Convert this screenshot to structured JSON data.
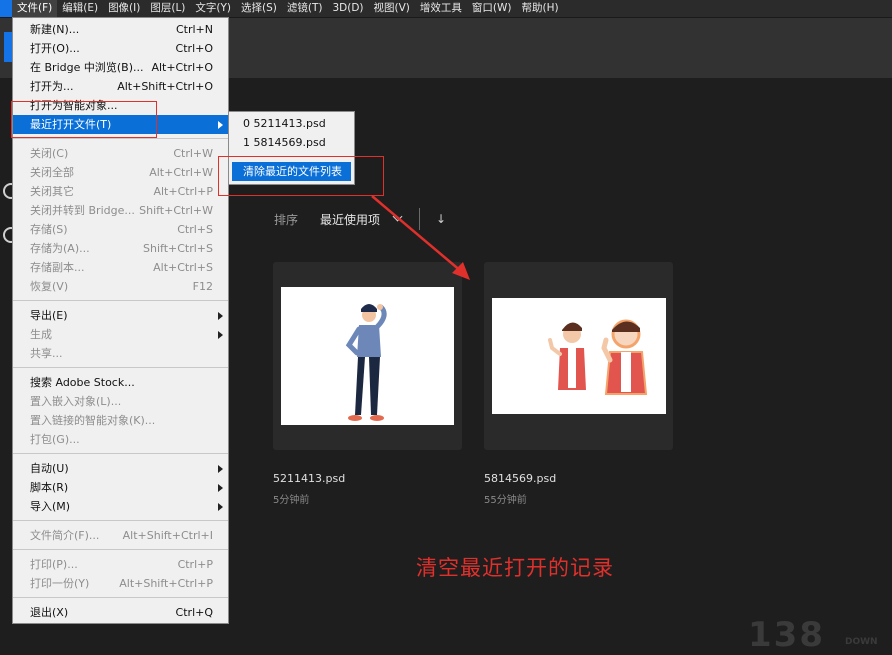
{
  "menubar": {
    "items": [
      "文件(F)",
      "编辑(E)",
      "图像(I)",
      "图层(L)",
      "文字(Y)",
      "选择(S)",
      "滤镜(T)",
      "3D(D)",
      "视图(V)",
      "增效工具",
      "窗口(W)",
      "帮助(H)"
    ]
  },
  "file_menu": {
    "items": [
      {
        "label": "新建(N)...",
        "shortcut": "Ctrl+N",
        "enabled": true
      },
      {
        "label": "打开(O)...",
        "shortcut": "Ctrl+O",
        "enabled": true
      },
      {
        "label": "在 Bridge 中浏览(B)...",
        "shortcut": "Alt+Ctrl+O",
        "enabled": true
      },
      {
        "label": "打开为...",
        "shortcut": "Alt+Shift+Ctrl+O",
        "enabled": true
      },
      {
        "label": "打开为智能对象...",
        "shortcut": "",
        "enabled": true
      },
      {
        "label": "最近打开文件(T)",
        "shortcut": "",
        "enabled": true,
        "submenu": true,
        "highlighted": true
      },
      {
        "label": "关闭(C)",
        "shortcut": "Ctrl+W",
        "enabled": false
      },
      {
        "label": "关闭全部",
        "shortcut": "Alt+Ctrl+W",
        "enabled": false
      },
      {
        "label": "关闭其它",
        "shortcut": "Alt+Ctrl+P",
        "enabled": false
      },
      {
        "label": "关闭并转到 Bridge...",
        "shortcut": "Shift+Ctrl+W",
        "enabled": false
      },
      {
        "label": "存储(S)",
        "shortcut": "Ctrl+S",
        "enabled": false
      },
      {
        "label": "存储为(A)...",
        "shortcut": "Shift+Ctrl+S",
        "enabled": false
      },
      {
        "label": "存储副本...",
        "shortcut": "Alt+Ctrl+S",
        "enabled": false
      },
      {
        "label": "恢复(V)",
        "shortcut": "F12",
        "enabled": false
      },
      {
        "label": "导出(E)",
        "shortcut": "",
        "enabled": true,
        "submenu": true
      },
      {
        "label": "生成",
        "shortcut": "",
        "enabled": false,
        "submenu": true
      },
      {
        "label": "共享...",
        "shortcut": "",
        "enabled": false
      },
      {
        "label": "搜索 Adobe Stock...",
        "shortcut": "",
        "enabled": true
      },
      {
        "label": "置入嵌入对象(L)...",
        "shortcut": "",
        "enabled": false
      },
      {
        "label": "置入链接的智能对象(K)...",
        "shortcut": "",
        "enabled": false
      },
      {
        "label": "打包(G)...",
        "shortcut": "",
        "enabled": false
      },
      {
        "label": "自动(U)",
        "shortcut": "",
        "enabled": true,
        "submenu": true
      },
      {
        "label": "脚本(R)",
        "shortcut": "",
        "enabled": true,
        "submenu": true
      },
      {
        "label": "导入(M)",
        "shortcut": "",
        "enabled": true,
        "submenu": true
      },
      {
        "label": "文件简介(F)...",
        "shortcut": "Alt+Shift+Ctrl+I",
        "enabled": false
      },
      {
        "label": "打印(P)...",
        "shortcut": "Ctrl+P",
        "enabled": false
      },
      {
        "label": "打印一份(Y)",
        "shortcut": "Alt+Shift+Ctrl+P",
        "enabled": false
      },
      {
        "label": "退出(X)",
        "shortcut": "Ctrl+Q",
        "enabled": true
      }
    ]
  },
  "recent_submenu": {
    "items": [
      "0  5211413.psd",
      "1  5814569.psd"
    ],
    "clear_label": "清除最近的文件列表"
  },
  "home": {
    "sort_label": "排序",
    "sort_value": "最近使用项",
    "down_arrow": "↓",
    "files": [
      {
        "name": "5211413.psd",
        "time": "5分钟前"
      },
      {
        "name": "5814569.psd",
        "time": "55分钟前"
      }
    ]
  },
  "annotation": "清空最近打开的记录",
  "watermark": "138",
  "watermark_small": "DOWN",
  "colors": {
    "highlight": "#0a6fd6",
    "annotation_red": "#e0302c",
    "app_blue": "#1473e6"
  }
}
